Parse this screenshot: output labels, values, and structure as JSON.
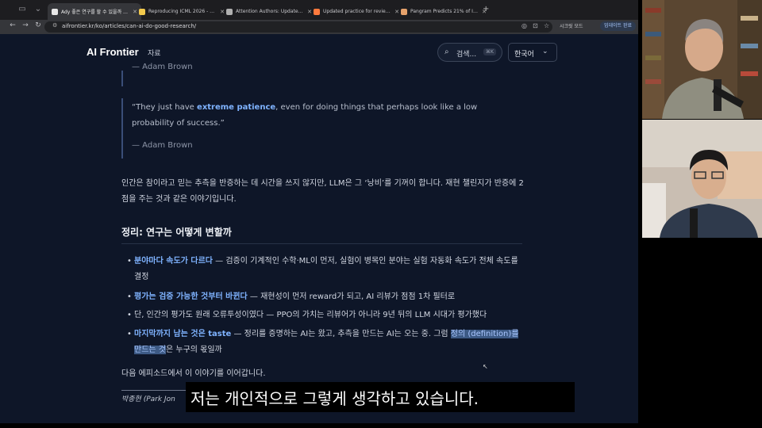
{
  "browser": {
    "tabs": [
      {
        "label": "Ady 좋은 연구를 할 수 있을까 – AI Frontier",
        "favicon_color": "#e8e8e8",
        "active": true
      },
      {
        "label": "Reproducing ICML 2026 - a...",
        "favicon_color": "#f2c94c",
        "active": false
      },
      {
        "label": "Attention Authors: Updated P...",
        "favicon_color": "#b0b0b0",
        "active": false
      },
      {
        "label": "Updated practice for review ...",
        "favicon_color": "#ff7a3d",
        "active": false
      },
      {
        "label": "Pangram Predicts 21% of ICL...",
        "favicon_color": "#e6a26b",
        "active": false
      }
    ],
    "url": "aifrontier.kr/ko/articles/can-ai-do-good-research/",
    "translate_label": "시크릿 모드",
    "update_label": "업데이트 완료"
  },
  "site": {
    "logo": "AI Frontier",
    "nav_resources": "자료",
    "search_label": "검색...",
    "search_shortcut": "⌘K",
    "language": "한국어"
  },
  "article": {
    "quote1_author": "— Adam Brown",
    "quote2_before": "“They just have ",
    "quote2_highlight": "extreme patience",
    "quote2_after": ", even for doing things that perhaps look like a low probability of success.”",
    "quote2_author": "— Adam Brown",
    "paragraph1": "인간은 참이라고 믿는 추측을 반증하는 데 시간을 쓰지 않지만, LLM은 그 ‘낭비’를 기꺼이 합니다. 재현 챌린지가 반증에 2점을 주는 것과 같은 이야기입니다.",
    "section_heading": "정리: 연구는 어떻게 변할까",
    "list": [
      {
        "strong": "분야마다 속도가 다르다",
        "rest": " — 검증이 기계적인 수학·ML이 먼저, 실험이 병목인 분야는 실험 자동화 속도가 전체 속도를 결정"
      },
      {
        "strong": "평가는 검증 가능한 것부터 바뀐다",
        "rest": " — 재현성이 먼저 reward가 되고, AI 리뷰가 점점 1차 필터로"
      },
      {
        "strong": "",
        "rest": "단, 인간의 평가도 원래 오류투성이였다 — PPO의 가치는 리뷰어가 아니라 9년 뒤의 LLM 시대가 평가했다"
      },
      {
        "strong": "마지막까지 남는 것은 taste",
        "rest": " — 정리를 증명하는 AI는 왔고, 추측을 만드는 AI는 오는 중. 그럼 ",
        "selected": "정의 (definition)를 만드는 것",
        "tail": "은 누구의 몫일까"
      }
    ],
    "paragraph2": "다음 에피소드에서 이 이야기를 이어갑니다.",
    "byline": "박종현 (Park Jon"
  },
  "subtitle": "저는 개인적으로 그렇게 생각하고 있습니다."
}
